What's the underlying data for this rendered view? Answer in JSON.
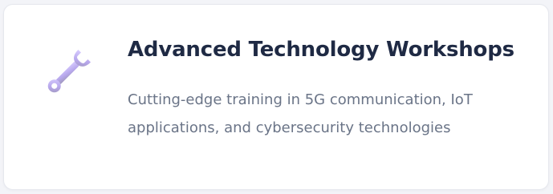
{
  "card": {
    "icon": "wrench-icon",
    "title": "Advanced Technology Workshops",
    "description": "Cutting-edge training in 5G communication, IoT applications, and cybersecurity technologies"
  },
  "colors": {
    "title": "#1f2a44",
    "description": "#6a7487",
    "icon_accent": "#b9a6ee"
  }
}
